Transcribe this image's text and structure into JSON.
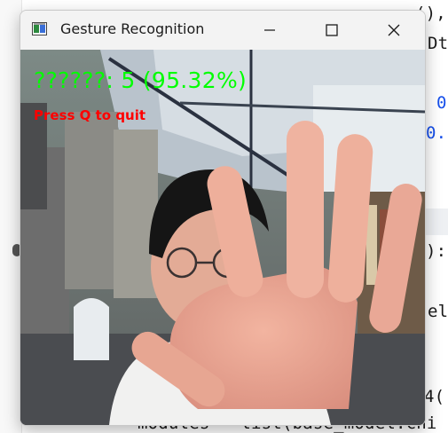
{
  "editor": {
    "lines": [
      {
        "text": "(),"
      },
      {
        "text": "Dt"
      },
      {
        "text": "0"
      },
      {
        "text": "0."
      },
      {
        "text": "):"
      },
      {
        "text": "el_"
      },
      {
        "text": "4("
      },
      {
        "text": "modules = list(base_model.chi"
      }
    ]
  },
  "window": {
    "title": "Gesture Recognition",
    "icon": "app-window-icon",
    "minimize_icon": "minimize-icon",
    "maximize_icon": "maximize-icon",
    "close_icon": "close-icon"
  },
  "overlay": {
    "prediction": "??????: 5 (95.32%)",
    "hint": "Press Q to quit",
    "prediction_color": "#00ff00",
    "hint_color": "#ff0000"
  }
}
